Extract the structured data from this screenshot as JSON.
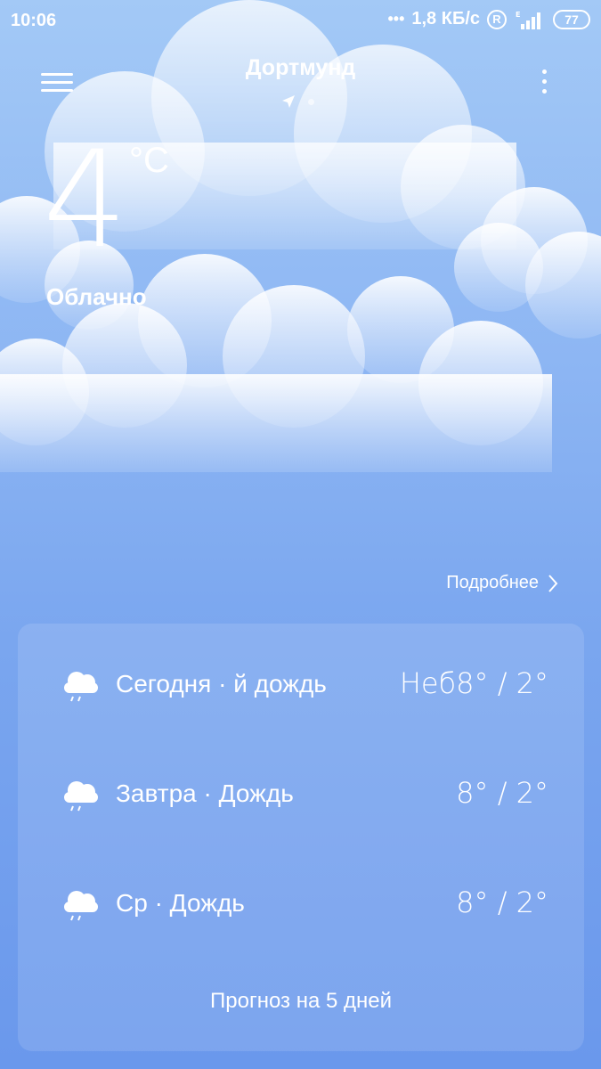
{
  "status_bar": {
    "time": "10:06",
    "net_speed": "1,8 КБ/с",
    "roaming": "R",
    "battery": "77"
  },
  "header": {
    "city": "Дортмунд"
  },
  "current": {
    "temperature": "4",
    "unit": "°C",
    "condition": "Облачно"
  },
  "details_label": "Подробнее",
  "forecast": {
    "days": [
      {
        "label": "Сегодня · й дождь",
        "temps": "Неб8° / 2°",
        "icon": "rain-cloud-icon"
      },
      {
        "label": "Завтра · Дождь",
        "temps": "8° / 2°",
        "icon": "rain-cloud-icon"
      },
      {
        "label": "Ср · Дождь",
        "temps": "8° / 2°",
        "icon": "rain-cloud-icon"
      }
    ],
    "more_label": "Прогноз на 5 дней"
  },
  "colors": {
    "sky_top": "#a3c9f6",
    "sky_bottom": "#6a98ec",
    "text": "#ffffff"
  }
}
